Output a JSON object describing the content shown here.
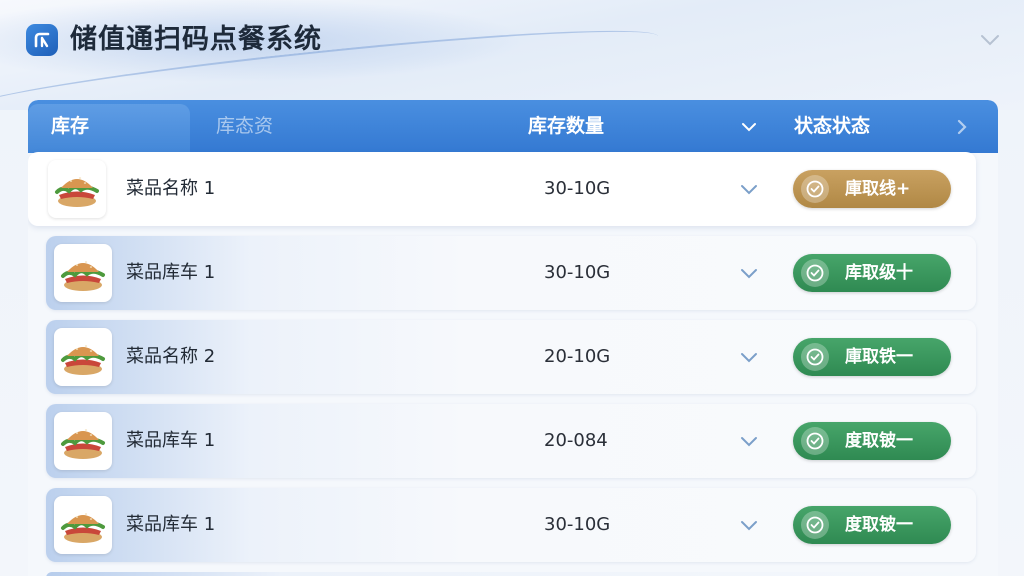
{
  "header": {
    "title": "储值通扫码点餐系统",
    "logo_icon": "app-logo-icon",
    "collapse_icon": "chevron-down-icon"
  },
  "table": {
    "tabs": [
      {
        "label": "库存",
        "active": true
      },
      {
        "label": "库态资",
        "active": false
      }
    ],
    "columns": {
      "quantity": "库存数量",
      "status": "状态状态"
    },
    "rows": [
      {
        "name": "菜品名称 1",
        "quantity": "30-10G",
        "status": "庫取线+",
        "status_color": "#b99250"
      },
      {
        "name": "菜品库车 1",
        "quantity": "30-10G",
        "status": "库取级十",
        "status_color": "#379459"
      },
      {
        "name": "菜品名称 2",
        "quantity": "20-10G",
        "status": "庫取铁一",
        "status_color": "#379459"
      },
      {
        "name": "菜品库车 1",
        "quantity": "20-084",
        "status": "度取铍一",
        "status_color": "#379459"
      },
      {
        "name": "菜品库车 1",
        "quantity": "30-10G",
        "status": "度取铍一",
        "status_color": "#379459"
      }
    ]
  },
  "colors": {
    "header_blue": "#3479d2",
    "gold": "#b99250",
    "green": "#379459"
  }
}
